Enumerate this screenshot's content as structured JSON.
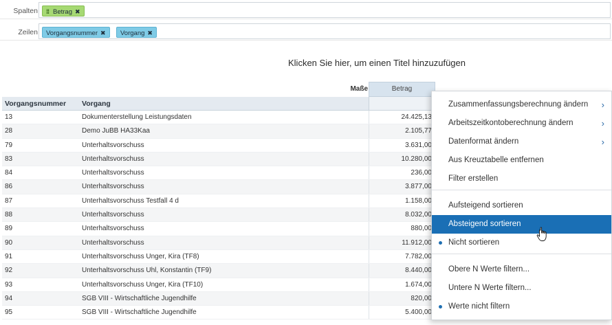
{
  "shelves": {
    "columns_label": "Spalten",
    "columns_pill": "Betrag",
    "rows_label": "Zeilen",
    "rows_pills": [
      "Vorgangsnummer",
      "Vorgang"
    ],
    "remove_symbol": "✖",
    "drag_symbol": "⁞⁞"
  },
  "chart_title": "Klicken Sie hier, um einen Titel hinzuzufügen",
  "table": {
    "measures_label": "Maße",
    "measure_header": "Betrag",
    "col1_header": "Vorgangsnummer",
    "col2_header": "Vorgang",
    "rows": [
      {
        "num": "13",
        "name": "Dokumenterstellung Leistungsdaten",
        "amount": "24.425,13"
      },
      {
        "num": "28",
        "name": "Demo JuBB HA33Kaa",
        "amount": "2.105,77"
      },
      {
        "num": "79",
        "name": "Unterhaltsvorschuss",
        "amount": "3.631,00"
      },
      {
        "num": "83",
        "name": "Unterhaltsvorschuss",
        "amount": "10.280,00"
      },
      {
        "num": "84",
        "name": "Unterhaltsvorschuss",
        "amount": "236,00"
      },
      {
        "num": "86",
        "name": "Unterhaltsvorschuss",
        "amount": "3.877,00"
      },
      {
        "num": "87",
        "name": "Unterhaltsvorschuss Testfall 4 d",
        "amount": "1.158,00"
      },
      {
        "num": "88",
        "name": "Unterhaltsvorschuss",
        "amount": "8.032,00"
      },
      {
        "num": "89",
        "name": "Unterhaltsvorschuss",
        "amount": "880,00"
      },
      {
        "num": "90",
        "name": "Unterhaltsvorschuss",
        "amount": "11.912,00"
      },
      {
        "num": "91",
        "name": "Unterhaltsvorschuss Unger, Kira (TF8)",
        "amount": "7.782,00"
      },
      {
        "num": "92",
        "name": "Unterhaltsvorschuss Uhl, Konstantin (TF9)",
        "amount": "8.440,00"
      },
      {
        "num": "93",
        "name": "Unterhaltsvorschuss Unger, Kira (TF10)",
        "amount": "1.674,00"
      },
      {
        "num": "94",
        "name": "SGB VIII - Wirtschaftliche Jugendhilfe",
        "amount": "820,00"
      },
      {
        "num": "95",
        "name": "SGB VIII - Wirtschaftliche Jugendhilfe",
        "amount": "5.400,00"
      }
    ]
  },
  "context_menu": {
    "items": [
      {
        "label": "Zusammenfassungsberechnung ändern",
        "submenu": true
      },
      {
        "label": "Arbeitszeitkontoberechnung ändern",
        "submenu": true
      },
      {
        "label": "Datenformat ändern",
        "submenu": true
      },
      {
        "label": "Aus Kreuztabelle entfernen"
      },
      {
        "label": "Filter erstellen"
      },
      {
        "label": "Aufsteigend sortieren"
      },
      {
        "label": "Absteigend sortieren",
        "highlighted": true
      },
      {
        "label": "Nicht sortieren",
        "selected": true
      },
      {
        "label": "Obere N Werte filtern..."
      },
      {
        "label": "Untere N Werte filtern..."
      },
      {
        "label": "Werte nicht filtern",
        "selected": true
      }
    ],
    "submenu_arrow": "›"
  },
  "colors": {
    "highlight": "#1a6fb5",
    "pill_green": "#a6d973",
    "pill_blue": "#7fcbe6"
  }
}
